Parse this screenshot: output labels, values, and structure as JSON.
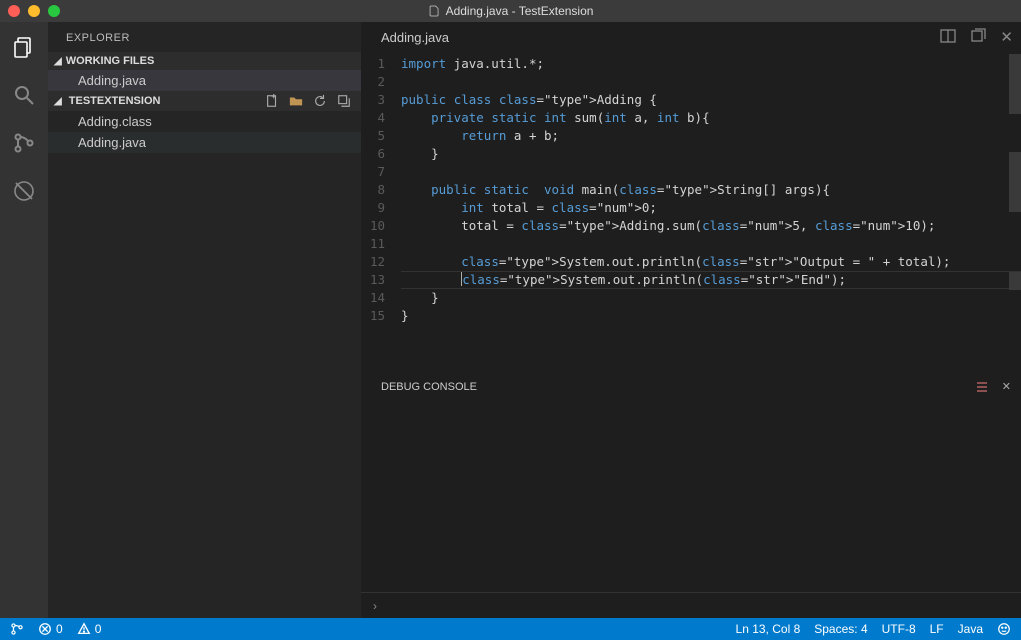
{
  "titlebar": {
    "title": "Adding.java - TestExtension"
  },
  "sidebar": {
    "title": "EXPLORER",
    "sections": {
      "working": {
        "label": "WORKING FILES",
        "items": [
          "Adding.java"
        ]
      },
      "folder": {
        "label": "TESTEXTENSION",
        "items": [
          "Adding.class",
          "Adding.java"
        ]
      }
    }
  },
  "editor": {
    "tab": "Adding.java",
    "lines": [
      "import java.util.*;",
      "",
      "public class Adding {",
      "    private static int sum(int a, int b){",
      "        return a + b;",
      "    }",
      "",
      "    public static  void main(String[] args){",
      "        int total = 0;",
      "        total = Adding.sum(5, 10);",
      "",
      "        System.out.println(\"Output = \" + total);",
      "        System.out.println(\"End\");",
      "    }",
      "}"
    ],
    "current_line": 13
  },
  "panel": {
    "title": "DEBUG CONSOLE",
    "repl_prompt": "›"
  },
  "status": {
    "errors": "0",
    "warnings": "0",
    "ln_col": "Ln 13, Col 8",
    "spaces": "Spaces: 4",
    "encoding": "UTF-8",
    "eol": "LF",
    "lang": "Java"
  }
}
